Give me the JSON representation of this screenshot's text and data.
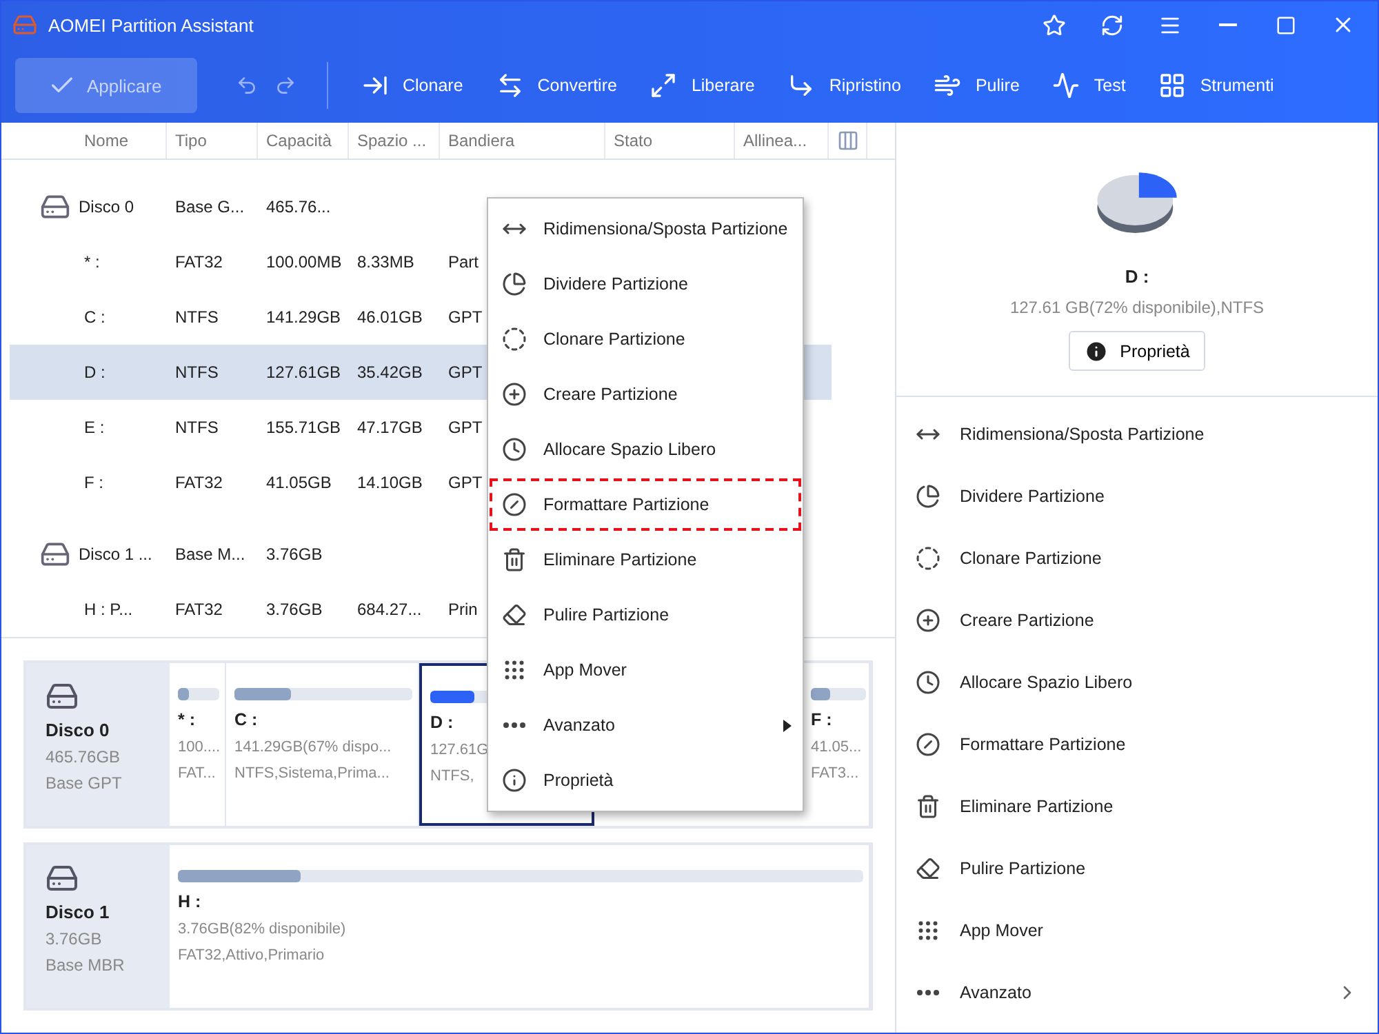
{
  "window": {
    "title": "AOMEI Partition Assistant"
  },
  "toolbar": {
    "apply": {
      "label": "Applicare",
      "disabled": true
    },
    "tools": [
      {
        "label": "Clonare"
      },
      {
        "label": "Convertire"
      },
      {
        "label": "Liberare"
      },
      {
        "label": "Ripristino"
      },
      {
        "label": "Pulire"
      },
      {
        "label": "Test"
      },
      {
        "label": "Strumenti"
      }
    ]
  },
  "table": {
    "columns": [
      "Nome",
      "Tipo",
      "Capacità",
      "Spazio ...",
      "Bandiera",
      "Stato",
      "Allinea..."
    ],
    "rows": [
      {
        "kind": "disk",
        "name": "Disco 0",
        "type": "Base G...",
        "capacity": "465.76...",
        "selected": false
      },
      {
        "kind": "partition",
        "name": "* :",
        "type": "FAT32",
        "capacity": "100.00MB",
        "used": "8.33MB",
        "flag": "Part",
        "selected": false
      },
      {
        "kind": "partition",
        "name": "C :",
        "type": "NTFS",
        "capacity": "141.29GB",
        "used": "46.01GB",
        "flag": "GPT",
        "selected": false
      },
      {
        "kind": "partition",
        "name": "D :",
        "type": "NTFS",
        "capacity": "127.61GB",
        "used": "35.42GB",
        "flag": "GPT",
        "selected": true
      },
      {
        "kind": "partition",
        "name": "E :",
        "type": "NTFS",
        "capacity": "155.71GB",
        "used": "47.17GB",
        "flag": "GPT",
        "selected": false
      },
      {
        "kind": "partition",
        "name": "F :",
        "type": "FAT32",
        "capacity": "41.05GB",
        "used": "14.10GB",
        "flag": "GPT",
        "selected": false
      },
      {
        "kind": "disk",
        "name": "Disco 1 ...",
        "type": "Base M...",
        "capacity": "3.76GB",
        "selected": false
      },
      {
        "kind": "partition",
        "name": "H : P...",
        "type": "FAT32",
        "capacity": "3.76GB",
        "used": "684.27...",
        "flag": "Prin",
        "selected": false
      }
    ]
  },
  "disk_map": [
    {
      "name": "Disco 0",
      "size": "465.76GB",
      "style": "Base GPT",
      "partitions": [
        {
          "label": "* :",
          "info": "100....",
          "detail": "FAT...",
          "level": 0.25,
          "selected": false
        },
        {
          "label": "C :",
          "info": "141.29GB(67% dispo...",
          "detail": "NTFS,Sistema,Prima...",
          "level": 0.32,
          "selected": false
        },
        {
          "label": "D :",
          "info": "127.61G",
          "detail": "NTFS,",
          "level": 0.28,
          "selected": true
        },
        {
          "label": "F :",
          "info": "41.05...",
          "detail": "FAT3...",
          "level": 0.35,
          "selected": false
        }
      ]
    },
    {
      "name": "Disco 1",
      "size": "3.76GB",
      "style": "Base MBR",
      "partitions": [
        {
          "label": "H :",
          "info": "3.76GB(82% disponibile)",
          "detail": "FAT32,Attivo,Primario",
          "level": 0.18,
          "selected": false
        }
      ]
    }
  ],
  "context_menu": [
    {
      "label": "Ridimensiona/Sposta Partizione",
      "highlighted": false,
      "submenu": false
    },
    {
      "label": "Dividere Partizione",
      "highlighted": false,
      "submenu": false
    },
    {
      "label": "Clonare Partizione",
      "highlighted": false,
      "submenu": false
    },
    {
      "label": "Creare Partizione",
      "highlighted": false,
      "submenu": false
    },
    {
      "label": "Allocare Spazio Libero",
      "highlighted": false,
      "submenu": false
    },
    {
      "label": "Formattare Partizione",
      "highlighted": true,
      "submenu": false
    },
    {
      "label": "Eliminare Partizione",
      "highlighted": false,
      "submenu": false
    },
    {
      "label": "Pulire Partizione",
      "highlighted": false,
      "submenu": false
    },
    {
      "label": "App Mover",
      "highlighted": false,
      "submenu": false
    },
    {
      "label": "Avanzato",
      "highlighted": false,
      "submenu": true
    },
    {
      "label": "Proprietà",
      "highlighted": false,
      "submenu": false
    }
  ],
  "details": {
    "name": "D :",
    "info": "127.61 GB(72% disponibile),NTFS",
    "button": "Proprietà",
    "operations": [
      {
        "label": "Ridimensiona/Sposta Partizione",
        "submenu": false
      },
      {
        "label": "Dividere Partizione",
        "submenu": false
      },
      {
        "label": "Clonare Partizione",
        "submenu": false
      },
      {
        "label": "Creare Partizione",
        "submenu": false
      },
      {
        "label": "Allocare Spazio Libero",
        "submenu": false
      },
      {
        "label": "Formattare Partizione",
        "submenu": false
      },
      {
        "label": "Eliminare Partizione",
        "submenu": false
      },
      {
        "label": "Pulire Partizione",
        "submenu": false
      },
      {
        "label": "App Mover",
        "submenu": false
      },
      {
        "label": "Avanzato",
        "submenu": true
      }
    ]
  }
}
